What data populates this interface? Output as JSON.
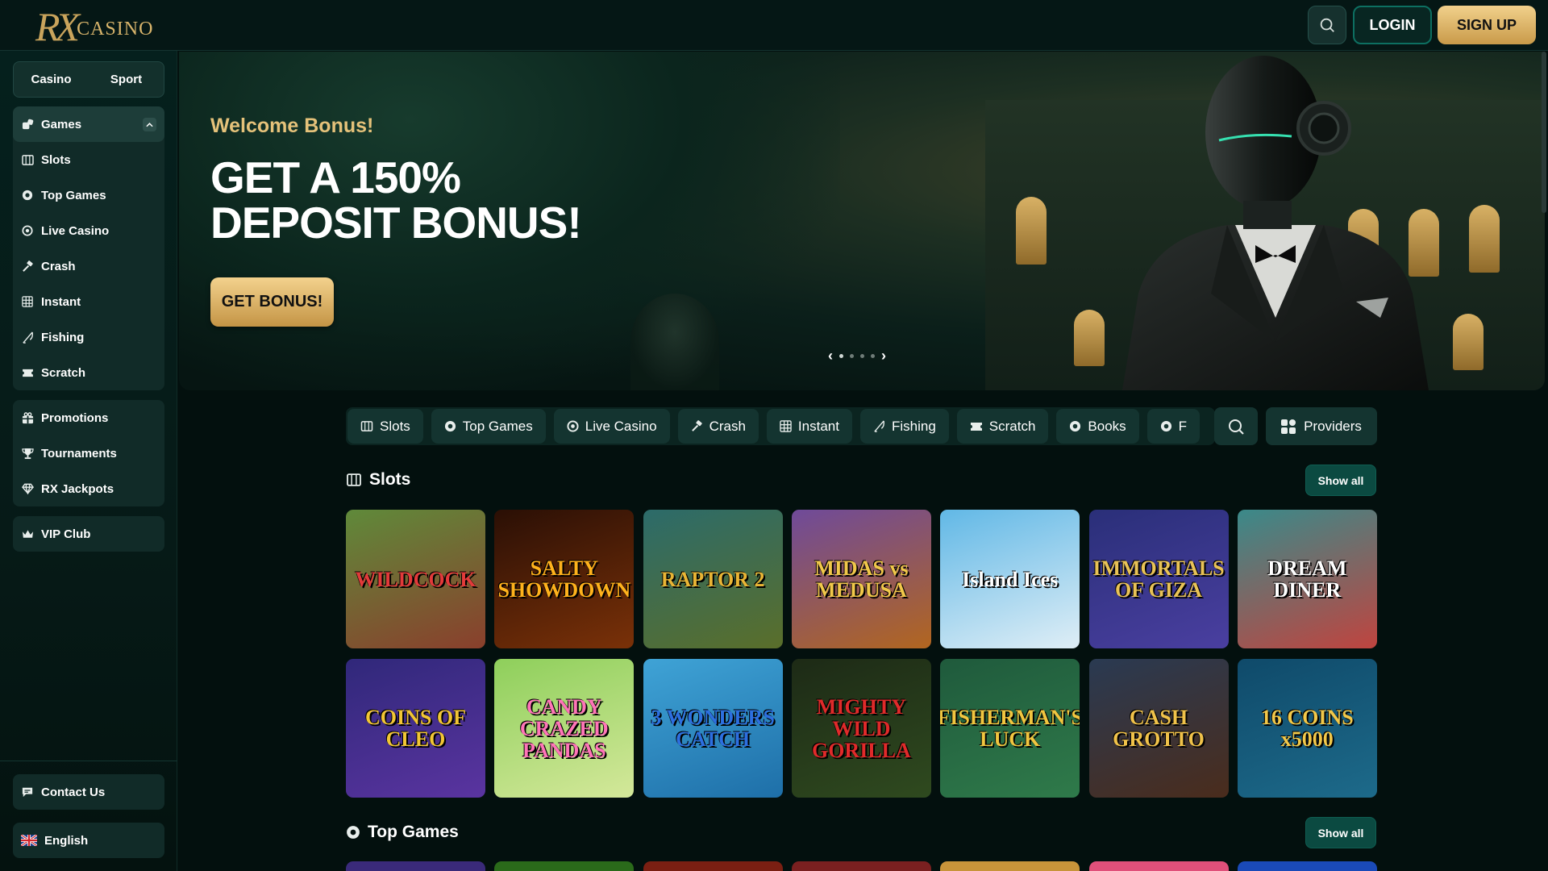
{
  "header": {
    "logo_monogram": "RX",
    "logo_text": "CASINO",
    "login": "LOGIN",
    "signup": "SIGN UP"
  },
  "sidebar": {
    "tabs": [
      "Casino",
      "Sport"
    ],
    "games_menu": [
      {
        "label": "Games",
        "icon": "games-icon"
      },
      {
        "label": "Slots",
        "icon": "slots-icon"
      },
      {
        "label": "Top Games",
        "icon": "chip-icon"
      },
      {
        "label": "Live Casino",
        "icon": "roulette-icon"
      },
      {
        "label": "Crash",
        "icon": "hammer-icon"
      },
      {
        "label": "Instant",
        "icon": "grid-icon"
      },
      {
        "label": "Fishing",
        "icon": "fishing-rod-icon"
      },
      {
        "label": "Scratch",
        "icon": "ticket-icon"
      }
    ],
    "promo_menu": [
      {
        "label": "Promotions",
        "icon": "gift-icon"
      },
      {
        "label": "Tournaments",
        "icon": "trophy-icon"
      },
      {
        "label": "RX Jackpots",
        "icon": "diamond-icon"
      }
    ],
    "vip": "VIP Club",
    "contact": "Contact Us",
    "language": "English"
  },
  "banner": {
    "welcome": "Welcome Bonus!",
    "headline_line1": "GET A 150%",
    "headline_line2": "DEPOSIT BONUS!",
    "cta": "GET BONUS!",
    "slide_current": 1,
    "slide_total": 5
  },
  "categories": {
    "items": [
      "Slots",
      "Top Games",
      "Live Casino",
      "Crash",
      "Instant",
      "Fishing",
      "Scratch",
      "Books",
      "F"
    ],
    "providers": "Providers"
  },
  "sections": {
    "slots": {
      "title": "Slots",
      "show_all": "Show all"
    },
    "top_games": {
      "title": "Top Games",
      "show_all": "Show all"
    }
  },
  "slots_games": [
    {
      "name": "WILDCOCK",
      "colors": [
        "#5f8a3a",
        "#8a3f2c"
      ],
      "text_color": "#e23a3a"
    },
    {
      "name": "SALTY SHOWDOWN",
      "colors": [
        "#2a0f05",
        "#7a3108"
      ],
      "text_color": "#ffb21c"
    },
    {
      "name": "RAPTOR 2",
      "colors": [
        "#2c6b6a",
        "#5a6e2a"
      ],
      "text_color": "#e9b535"
    },
    {
      "name": "MIDAS vs MEDUSA",
      "colors": [
        "#6f4a9a",
        "#b2661f"
      ],
      "text_color": "#f1c84a"
    },
    {
      "name": "Island Ices",
      "colors": [
        "#61b8e6",
        "#dfeef6"
      ],
      "text_color": "#ffffff"
    },
    {
      "name": "IMMORTALS OF GIZA",
      "colors": [
        "#2a2f79",
        "#4a3fa0"
      ],
      "text_color": "#e9c357"
    },
    {
      "name": "DREAM DINER",
      "colors": [
        "#3a8a8a",
        "#c0443f"
      ],
      "text_color": "#ffffff"
    },
    {
      "name": "COINS OF CLEO",
      "colors": [
        "#30287a",
        "#5a34a0"
      ],
      "text_color": "#f2c635"
    },
    {
      "name": "CANDY CRAZED PANDAS",
      "colors": [
        "#8ecf5b",
        "#d4e89a"
      ],
      "text_color": "#ff74b8"
    },
    {
      "name": "3 WONDERS CATCH",
      "colors": [
        "#3fa3d6",
        "#1e6fa8"
      ],
      "text_color": "#2d6fe0"
    },
    {
      "name": "MIGHTY WILD GORILLA",
      "colors": [
        "#1d2a16",
        "#2f4a1f"
      ],
      "text_color": "#e02a2a"
    },
    {
      "name": "FISHERMAN'S LUCK",
      "colors": [
        "#1f5a3c",
        "#2f7a4a"
      ],
      "text_color": "#f1c640"
    },
    {
      "name": "CASH GROTTO",
      "colors": [
        "#2a3a52",
        "#4a2c1c"
      ],
      "text_color": "#f0c24a"
    },
    {
      "name": "16 COINS x5000",
      "colors": [
        "#0f4a6a",
        "#1d6a8a"
      ],
      "text_color": "#f1c84a"
    }
  ],
  "top_games_peek_colors": [
    "#3a2a7a",
    "#2a6a1a",
    "#7a1f12",
    "#7a2020",
    "#c8943a",
    "#e0507a",
    "#1a4ab8"
  ]
}
